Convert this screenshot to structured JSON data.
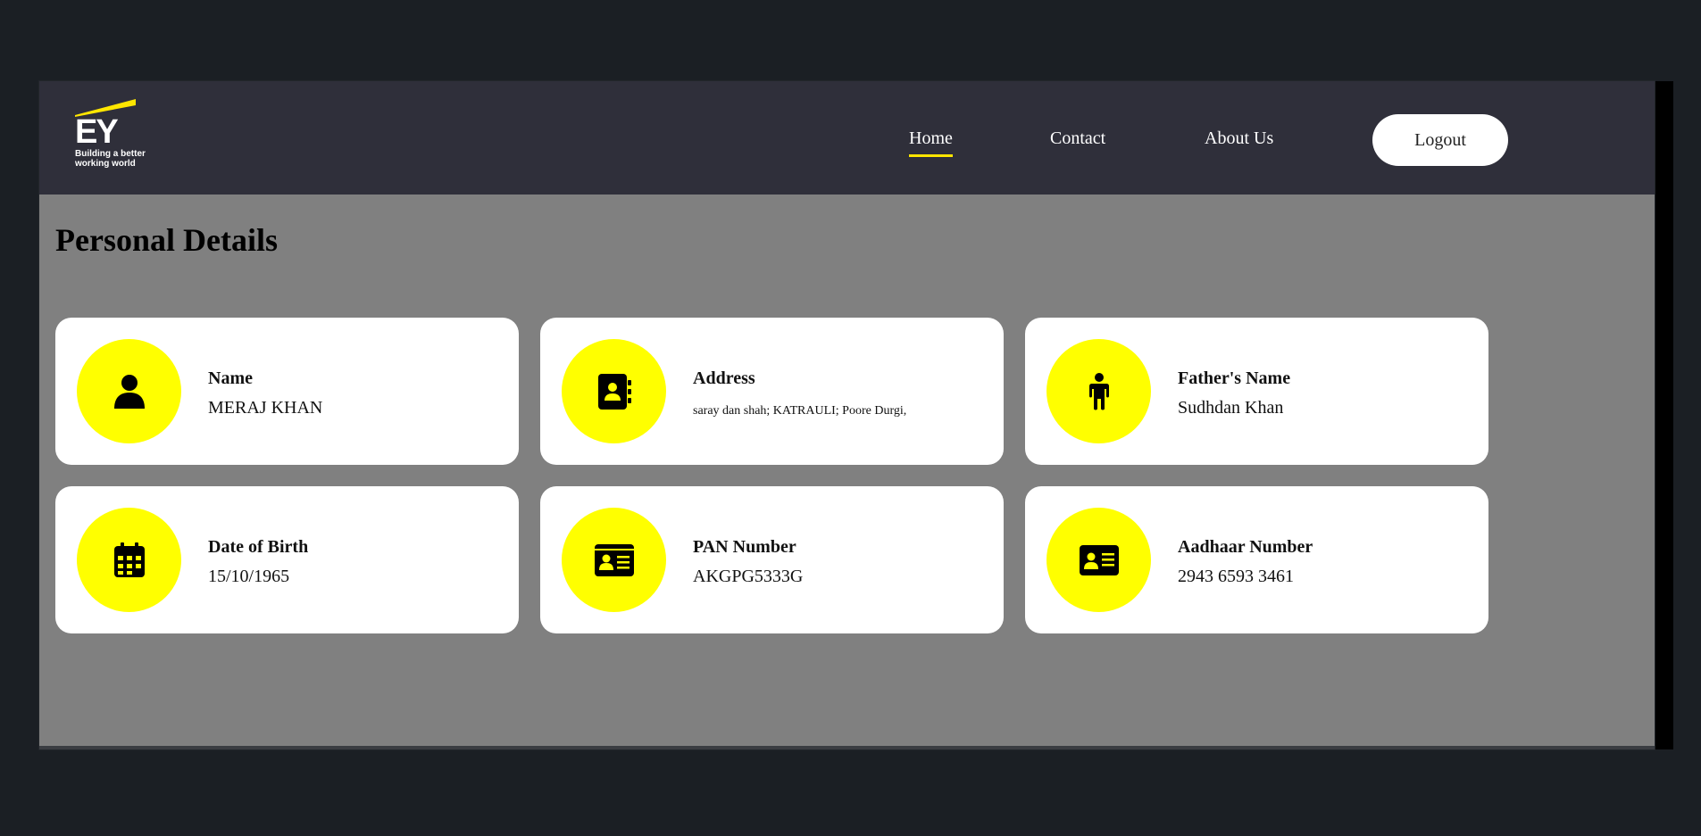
{
  "brand": {
    "logo_mark": "EY",
    "logo_tagline": "Building a better working world",
    "accent_color": "#ffe600"
  },
  "nav": {
    "items": [
      {
        "label": "Home",
        "active": true
      },
      {
        "label": "Contact",
        "active": false
      },
      {
        "label": "About Us",
        "active": false
      }
    ],
    "logout_label": "Logout"
  },
  "page": {
    "title": "Personal Details"
  },
  "cards": [
    {
      "label": "Name",
      "value": "MERAJ KHAN",
      "icon": "user-icon"
    },
    {
      "label": "Address",
      "value": "saray dan shah; KATRAULI; Poore Durgi,",
      "icon": "address-book-icon"
    },
    {
      "label": "Father's Name",
      "value": "Sudhdan Khan",
      "icon": "person-standing-icon"
    },
    {
      "label": "Date of Birth",
      "value": "15/10/1965",
      "icon": "calendar-icon"
    },
    {
      "label": "PAN Number",
      "value": "AKGPG5333G",
      "icon": "id-card-icon"
    },
    {
      "label": "Aadhaar Number",
      "value": "2943 6593 3461",
      "icon": "id-card-icon"
    }
  ]
}
